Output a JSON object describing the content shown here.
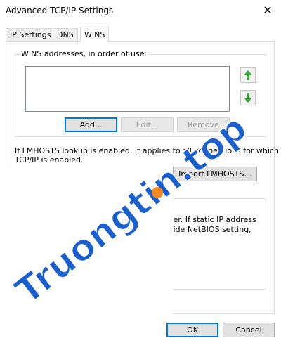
{
  "window": {
    "title": "Advanced TCP/IP Settings",
    "close_glyph": "✕"
  },
  "tabs": [
    {
      "label": "IP Settings"
    },
    {
      "label": "DNS"
    },
    {
      "label": "WINS"
    }
  ],
  "wins": {
    "group_label": "WINS addresses, in order of use:",
    "add_label": "Add...",
    "edit_label": "Edit...",
    "remove_label": "Remove",
    "up_icon": "arrow-up-icon",
    "down_icon": "arrow-down-icon"
  },
  "lmhosts": {
    "info_line1": "If LMHOSTS lookup is enabled, it applies to all connections for which",
    "info_line2": "TCP/IP is enabled.",
    "import_label": "Import LMHOSTS..."
  },
  "netbios": {
    "fragment_line1": "ver. If static IP address",
    "fragment_line2": "vide NetBIOS setting,"
  },
  "footer": {
    "ok_label": "OK",
    "cancel_label": "Cancel"
  },
  "watermark": {
    "text": "Truongtin.top"
  },
  "colors": {
    "accent": "#0078d7",
    "arrow_green": "#3aa23a",
    "watermark_blue": "#1a5fd0",
    "watermark_orange": "#f28a1e"
  }
}
